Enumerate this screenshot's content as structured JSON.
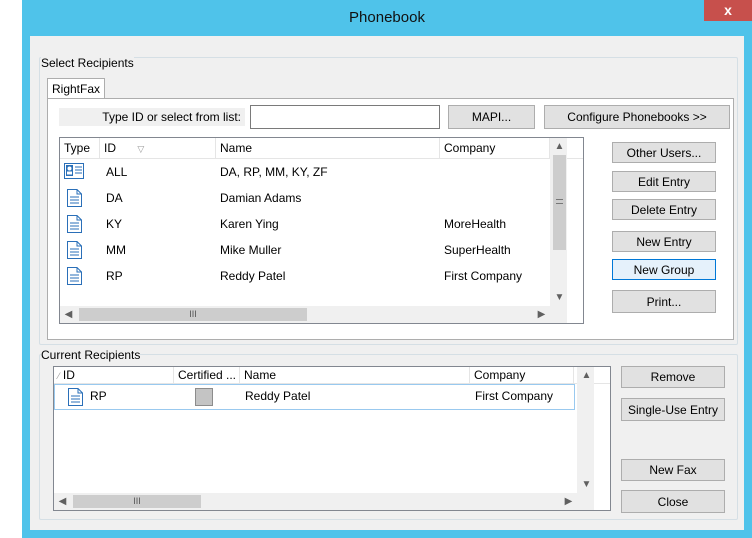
{
  "window": {
    "title": "Phonebook",
    "close_label": "x"
  },
  "select": {
    "group_label": "Select Recipients",
    "tab_label": "RightFax",
    "type_id_label": "Type ID or select from list:",
    "type_id_value": "",
    "mapi_button": "MAPI...",
    "configure_button": "Configure Phonebooks  >>",
    "columns": {
      "type": "Type",
      "id": "ID",
      "name": "Name",
      "company": "Company"
    },
    "rows": [
      {
        "icon": "group-icon",
        "id": "ALL",
        "name": "DA, RP, MM, KY, ZF",
        "company": ""
      },
      {
        "icon": "document-icon",
        "id": "DA",
        "name": "Damian Adams",
        "company": ""
      },
      {
        "icon": "document-icon",
        "id": "KY",
        "name": "Karen Ying",
        "company": "MoreHealth"
      },
      {
        "icon": "document-icon",
        "id": "MM",
        "name": "Mike Muller",
        "company": "SuperHealth"
      },
      {
        "icon": "document-icon",
        "id": "RP",
        "name": "Reddy Patel",
        "company": "First Company"
      }
    ],
    "buttons": {
      "other_users": "Other Users...",
      "edit_entry": "Edit Entry",
      "delete_entry": "Delete Entry",
      "new_entry": "New Entry",
      "new_group": "New Group",
      "print": "Print..."
    }
  },
  "current": {
    "group_label": "Current Recipients",
    "columns": {
      "id": "ID",
      "certified": "Certified ...",
      "name": "Name",
      "company": "Company"
    },
    "rows": [
      {
        "icon": "document-icon",
        "id": "RP",
        "certified": false,
        "name": "Reddy Patel",
        "company": "First Company"
      }
    ],
    "buttons": {
      "remove": "Remove",
      "single_use": "Single-Use Entry",
      "new_fax": "New Fax",
      "close": "Close"
    }
  },
  "scroll_grip": "III",
  "colors": {
    "title_bar": "#4fc3ea",
    "close_button": "#c7504c",
    "focus_border": "#0078d7"
  }
}
